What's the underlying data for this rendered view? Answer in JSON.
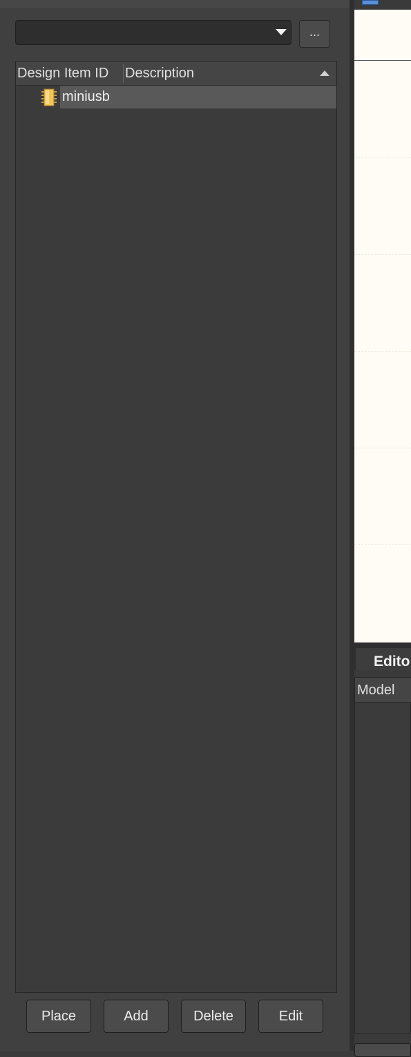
{
  "library_panel": {
    "library_select": {
      "value": ""
    },
    "browse_button_label": "...",
    "columns": {
      "design_item_id": "Design Item ID",
      "description": "Description"
    },
    "rows": [
      {
        "design_item_id": "miniusb",
        "description": "",
        "icon": "component-chip-icon"
      }
    ],
    "buttons": {
      "place": "Place",
      "add": "Add",
      "delete": "Delete",
      "edit": "Edit"
    }
  },
  "editor_panel": {
    "tab_label": "Edito",
    "model_column": "Model"
  },
  "colors": {
    "panel_bg": "#404040",
    "list_bg": "#3b3b3b",
    "row_selected": "#595959",
    "document_bg": "#fffcf5",
    "chip_icon": "#f2c45a"
  }
}
